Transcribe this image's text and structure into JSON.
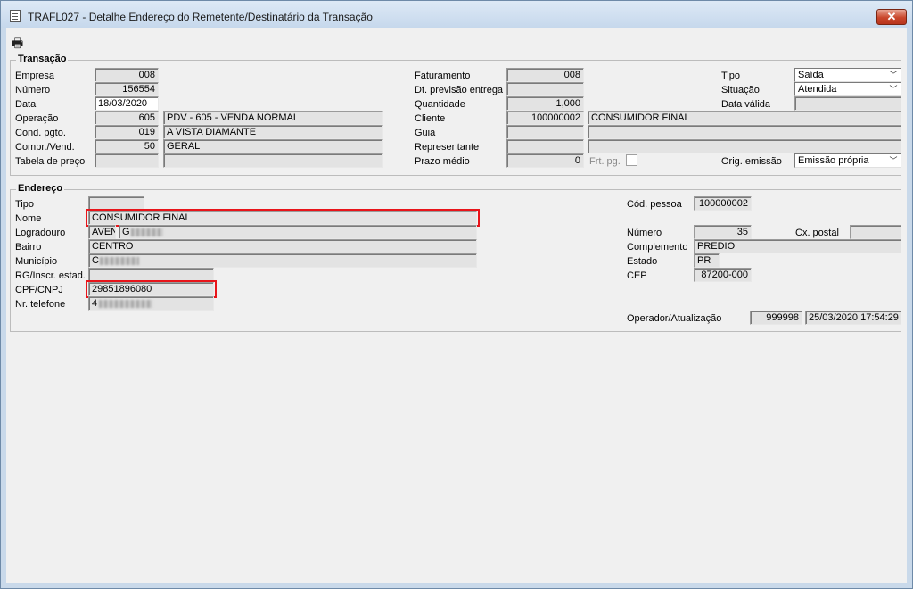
{
  "window": {
    "title": "TRAFL027 - Detalhe Endereço do Remetente/Destinatário da Transação",
    "close_label": "✕"
  },
  "toolbar": {
    "print_icon": "printer-icon"
  },
  "transacao": {
    "group_title": "Transação",
    "empresa": {
      "label": "Empresa",
      "value": "008"
    },
    "numero": {
      "label": "Número",
      "value": "156554"
    },
    "data": {
      "label": "Data",
      "value": "18/03/2020"
    },
    "operacao": {
      "label": "Operação",
      "code": "605",
      "desc": "PDV - 605 - VENDA NORMAL"
    },
    "cond_pgto": {
      "label": "Cond. pgto.",
      "code": "019",
      "desc": "A VISTA DIAMANTE"
    },
    "compr_vend": {
      "label": "Compr./Vend.",
      "code": "50",
      "desc": "GERAL"
    },
    "tabela_preco": {
      "label": "Tabela de preço",
      "code": "",
      "desc": ""
    },
    "faturamento": {
      "label": "Faturamento",
      "value": "008"
    },
    "dt_previsao": {
      "label": "Dt. previsão entrega",
      "value": ""
    },
    "quantidade": {
      "label": "Quantidade",
      "value": "1,000"
    },
    "cliente": {
      "label": "Cliente",
      "code": "100000002",
      "desc": "CONSUMIDOR FINAL"
    },
    "guia": {
      "label": "Guia",
      "code": "",
      "desc": ""
    },
    "representante": {
      "label": "Representante",
      "code": "",
      "desc": ""
    },
    "prazo_medio": {
      "label": "Prazo médio",
      "value": "0"
    },
    "frt_pg": {
      "label": "Frt. pg."
    },
    "tipo": {
      "label": "Tipo",
      "value": "Saída"
    },
    "situacao": {
      "label": "Situação",
      "value": "Atendida"
    },
    "data_valida": {
      "label": "Data válida",
      "value": ""
    },
    "orig_emissao": {
      "label": "Orig. emissão",
      "value": "Emissão própria"
    }
  },
  "endereco": {
    "group_title": "Endereço",
    "tipo": {
      "label": "Tipo",
      "value": ""
    },
    "nome": {
      "label": "Nome",
      "value": "CONSUMIDOR FINAL"
    },
    "logradouro": {
      "label": "Logradouro",
      "type": "AVEN",
      "value": "G"
    },
    "bairro": {
      "label": "Bairro",
      "value": "CENTRO"
    },
    "municipio": {
      "label": "Município",
      "value": "C"
    },
    "rg": {
      "label": "RG/Inscr. estad.",
      "value": ""
    },
    "cpf_cnpj": {
      "label": "CPF/CNPJ",
      "value": "29851896080"
    },
    "telefone": {
      "label": "Nr. telefone",
      "value": "4"
    },
    "cod_pessoa": {
      "label": "Cód. pessoa",
      "value": "100000002"
    },
    "numero": {
      "label": "Número",
      "value": "35"
    },
    "cx_postal": {
      "label": "Cx. postal",
      "value": ""
    },
    "complemento": {
      "label": "Complemento",
      "value": "PREDIO"
    },
    "estado": {
      "label": "Estado",
      "value": "PR"
    },
    "cep": {
      "label": "CEP",
      "value": "87200-000"
    },
    "operador": {
      "label": "Operador/Atualização",
      "code": "999998",
      "datetime": "25/03/2020 17:54:29"
    }
  },
  "colors": {
    "highlight": "#e8141a",
    "titlebar": "#c6d8ec",
    "close": "#c9462b"
  }
}
